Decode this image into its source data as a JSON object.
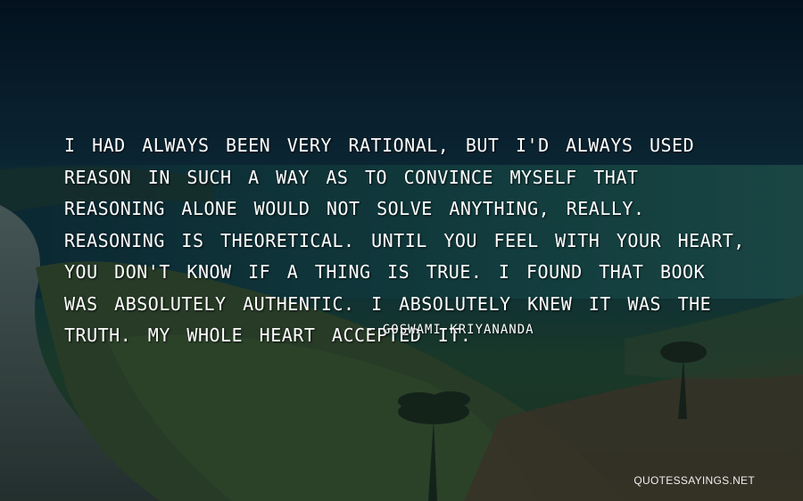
{
  "quote": {
    "text": "I had always been very rational, but I'd always used reason in such a way as to convince myself that reasoning alone would not solve anything, really. Reasoning is theoretical. Until you feel with your heart, you don't know if a thing is true. I found that book was absolutely authentic. I absolutely knew it was the truth. My whole heart accepted it.",
    "attribution": "- Goswami Kriyananda"
  },
  "watermark": "QUOTESSAYINGS.NET",
  "colors": {
    "text": "#ffffff",
    "sky": "#0b2a3d",
    "sea": "#194a49",
    "vegetation": "#2e4b2c"
  }
}
